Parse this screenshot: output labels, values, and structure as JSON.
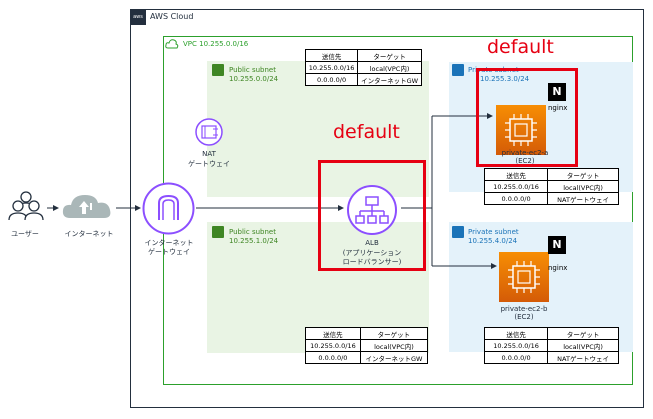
{
  "aws_cloud": {
    "label": "AWS Cloud",
    "logo": "aws"
  },
  "vpc": {
    "label": "VPC 10.255.0.0/16"
  },
  "user": {
    "label": "ユーザー"
  },
  "internet": {
    "label": "インターネット"
  },
  "igw": {
    "line1": "インターネット",
    "line2": "ゲートウェイ"
  },
  "nat": {
    "line1": "NAT",
    "line2": "ゲートウェイ"
  },
  "public_subnet_a": {
    "title": "Public subnet",
    "cidr": "10.255.0.0/24"
  },
  "public_subnet_c": {
    "title": "Public subnet",
    "cidr": "10.255.1.0/24"
  },
  "private_subnet_a": {
    "title": "Private subnet",
    "cidr": "10.255.3.0/24"
  },
  "private_subnet_c": {
    "title": "Private subnet",
    "cidr": "10.255.4.0/24"
  },
  "alb": {
    "line1": "ALB",
    "line2": "(アプリケーション",
    "line3": "ロードバランサー)"
  },
  "ec2_a": {
    "line1": "private-ec2-a",
    "line2": "(EC2)",
    "badge": "N",
    "software": "nginx"
  },
  "ec2_b": {
    "line1": "private-ec2-b",
    "line2": "(EC2)",
    "badge": "N",
    "software": "nginx"
  },
  "default_labels": {
    "alb": "default",
    "ec2": "default"
  },
  "route_table_public_top": {
    "headers": [
      "送信先",
      "ターゲット"
    ],
    "rows": [
      [
        "10.255.0.0/16",
        "local(VPC内)"
      ],
      [
        "0.0.0.0/0",
        "インターネットGW"
      ]
    ]
  },
  "route_table_public_bottom": {
    "headers": [
      "送信先",
      "ターゲット"
    ],
    "rows": [
      [
        "10.255.0.0/16",
        "local(VPC内)"
      ],
      [
        "0.0.0.0/0",
        "インターネットGW"
      ]
    ]
  },
  "route_table_private_top": {
    "headers": [
      "送信先",
      "ターゲット"
    ],
    "rows": [
      [
        "10.255.0.0/16",
        "local(VPC内)"
      ],
      [
        "0.0.0.0/0",
        "NATゲートウェイ"
      ]
    ]
  },
  "route_table_private_bottom": {
    "headers": [
      "送信先",
      "ターゲット"
    ],
    "rows": [
      [
        "10.255.0.0/16",
        "local(VPC内)"
      ],
      [
        "0.0.0.0/0",
        "NATゲートウェイ"
      ]
    ]
  },
  "colors": {
    "aws_border": "#232f3e",
    "vpc_border": "#2ca02c",
    "public_fill": "#e9f4e4",
    "private_fill": "#e4f2fa",
    "highlight": "#e60012",
    "ec2_orange": "#d45b07",
    "alb_purple": "#8c4fff"
  }
}
